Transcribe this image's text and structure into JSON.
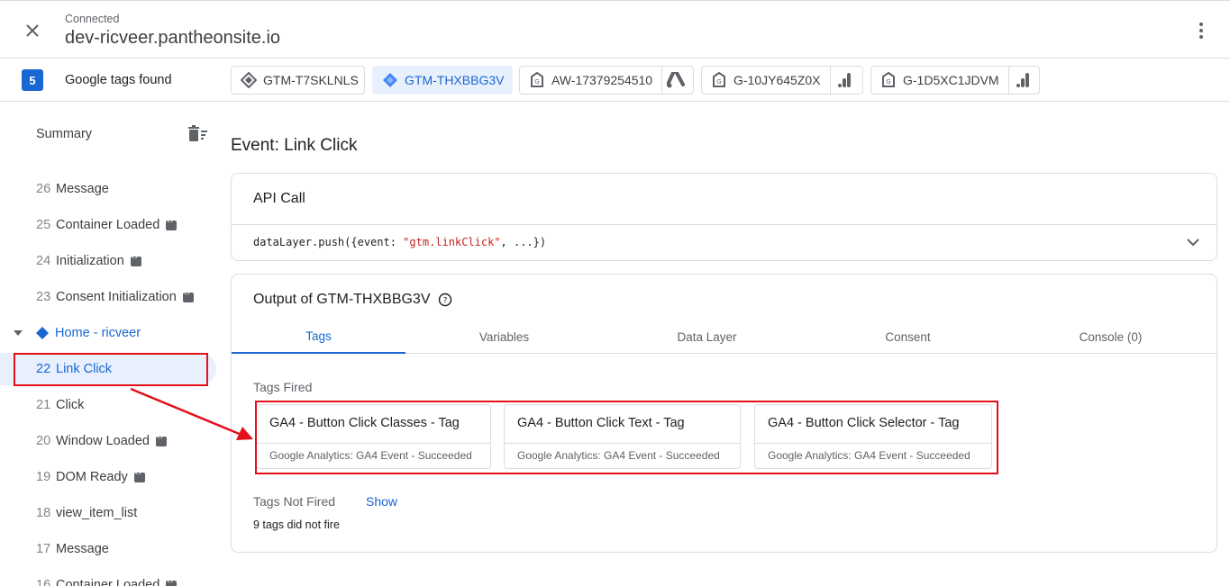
{
  "header": {
    "status": "Connected",
    "host": "dev-ricveer.pantheonsite.io"
  },
  "tags_bar": {
    "count": "5",
    "label": "Google tags found",
    "chips": [
      {
        "id": "GTM-T7SKLNLS",
        "icon": "gtm-diamond-icon",
        "active": false
      },
      {
        "id": "GTM-THXBBG3V",
        "icon": "gtm-diamond-icon",
        "active": true
      },
      {
        "id": "AW-17379254510",
        "icon": "google-tag-icon",
        "ext_icon": "google-ads-icon",
        "active": false
      },
      {
        "id": "G-10JY645Z0X",
        "icon": "google-tag-icon",
        "ext_icon": "analytics-icon",
        "active": false
      },
      {
        "id": "G-1D5XC1JDVM",
        "icon": "google-tag-icon",
        "ext_icon": "analytics-icon",
        "active": false
      }
    ]
  },
  "sidebar": {
    "summary": "Summary",
    "events_top": [
      {
        "num": "26",
        "label": "Message",
        "code": false
      },
      {
        "num": "25",
        "label": "Container Loaded",
        "code": true
      },
      {
        "num": "24",
        "label": "Initialization",
        "code": true
      },
      {
        "num": "23",
        "label": "Consent Initialization",
        "code": true
      }
    ],
    "page_group": "Home - ricveer",
    "events_bottom": [
      {
        "num": "22",
        "label": "Link Click",
        "code": false,
        "selected": true
      },
      {
        "num": "21",
        "label": "Click",
        "code": false
      },
      {
        "num": "20",
        "label": "Window Loaded",
        "code": true
      },
      {
        "num": "19",
        "label": "DOM Ready",
        "code": true
      },
      {
        "num": "18",
        "label": "view_item_list",
        "code": false
      },
      {
        "num": "17",
        "label": "Message",
        "code": false
      },
      {
        "num": "16",
        "label": "Container Loaded",
        "code": true
      }
    ]
  },
  "main": {
    "title": "Event: Link Click",
    "api_call": {
      "heading": "API Call",
      "code_prefix": "dataLayer.push({event: ",
      "code_string": "\"gtm.linkClick\"",
      "code_suffix": ", ...})"
    },
    "output": {
      "heading": "Output of GTM-THXBBG3V",
      "tabs": [
        "Tags",
        "Variables",
        "Data Layer",
        "Consent",
        "Console (0)"
      ],
      "active_tab": "Tags",
      "fired_label": "Tags Fired",
      "fired_tags": [
        {
          "name": "GA4 - Button Click Classes - Tag",
          "status": "Google Analytics: GA4 Event - Succeeded"
        },
        {
          "name": "GA4 - Button Click Text - Tag",
          "status": "Google Analytics: GA4 Event - Succeeded"
        },
        {
          "name": "GA4 - Button Click Selector - Tag",
          "status": "Google Analytics: GA4 Event - Succeeded"
        }
      ],
      "not_fired_label": "Tags Not Fired",
      "show_label": "Show",
      "not_fired_count": "9 tags did not fire"
    }
  },
  "colors": {
    "accent": "#1967d2",
    "annotation": "#e3101a"
  }
}
